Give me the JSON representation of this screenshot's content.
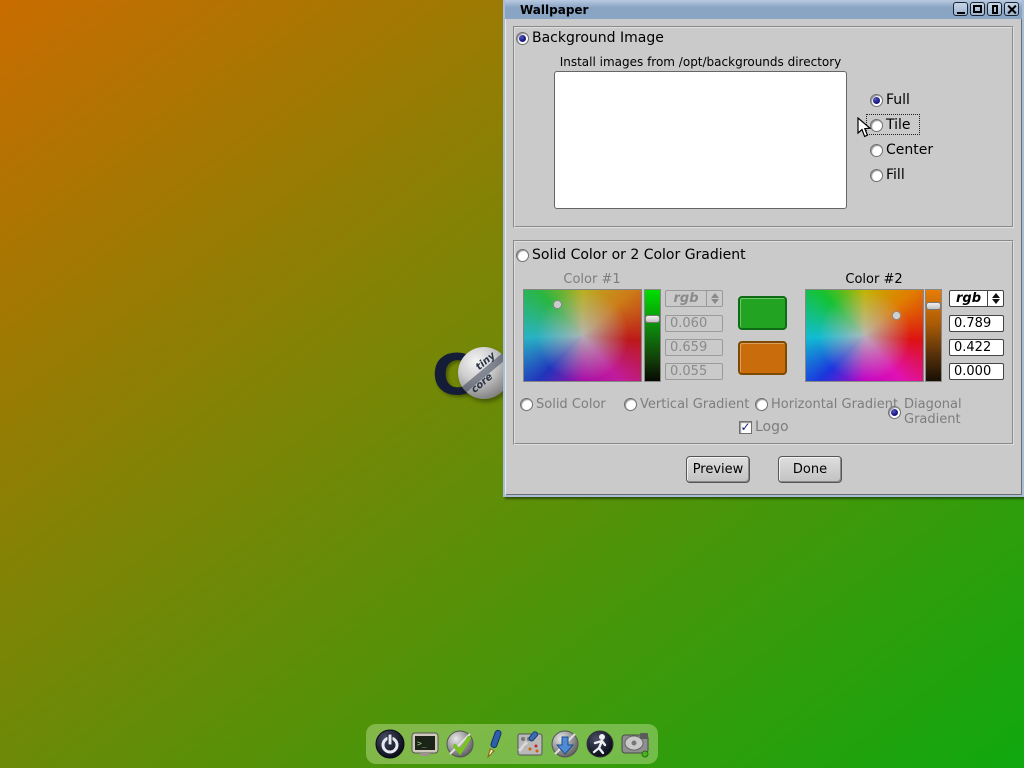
{
  "desktop": {
    "gradient_from": "#c96c00",
    "gradient_to": "#0fa80e",
    "logo": {
      "letter": "C",
      "ball_text_top": "tiny",
      "ball_text_bottom": "core"
    }
  },
  "window": {
    "title": "Wallpaper",
    "titlebar_color": "#8aa4c4"
  },
  "background_image_section": {
    "radio_label": "Background Image",
    "radio_selected": true,
    "install_hint": "Install images from /opt/backgrounds directory",
    "mode_options": [
      {
        "label": "Full",
        "selected": true
      },
      {
        "label": "Tile",
        "selected": false,
        "focused": true
      },
      {
        "label": "Center",
        "selected": false
      },
      {
        "label": "Fill",
        "selected": false
      }
    ]
  },
  "color_section": {
    "radio_label": "Solid Color or 2 Color Gradient",
    "radio_selected": false,
    "color1": {
      "label": "Color #1",
      "mode": "rgb",
      "values": [
        "0.060",
        "0.659",
        "0.055"
      ],
      "enabled": false,
      "swatch_color": "#22a322"
    },
    "color2": {
      "label": "Color #2",
      "mode": "rgb",
      "values": [
        "0.789",
        "0.422",
        "0.000"
      ],
      "enabled": true,
      "swatch_color": "#c96c0c"
    },
    "gradient_options": [
      {
        "label": "Solid Color",
        "selected": false
      },
      {
        "label": "Vertical Gradient",
        "selected": false
      },
      {
        "label": "Horizontal Gradient",
        "selected": false
      },
      {
        "label": "Diagonal Gradient",
        "selected": true
      }
    ],
    "logo_checkbox": {
      "label": "Logo",
      "checked": true,
      "check_glyph": "✓"
    }
  },
  "action_buttons": {
    "preview": "Preview",
    "done": "Done"
  },
  "dock": {
    "icons": [
      "power-icon",
      "terminal-icon",
      "apps-check-icon",
      "editor-pen-icon",
      "control-panel-icon",
      "apps-install-icon",
      "run-icon",
      "mount-drive-icon"
    ]
  }
}
